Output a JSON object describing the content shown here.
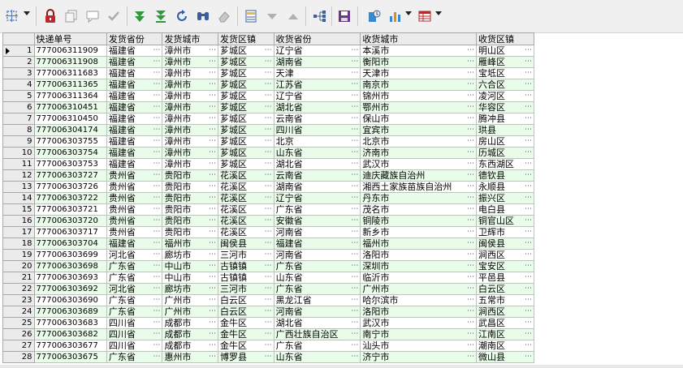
{
  "toolbar": {
    "buttons": [
      {
        "name": "column-config-icon",
        "dropdown": true
      },
      {
        "name": "lock-icon"
      },
      {
        "name": "copy-icon"
      },
      {
        "name": "chat-icon"
      },
      {
        "name": "check-icon"
      },
      {
        "name": "expand-down-icon"
      },
      {
        "name": "expand-all-icon"
      },
      {
        "name": "refresh-icon"
      },
      {
        "name": "find-icon"
      },
      {
        "name": "eraser-icon"
      },
      {
        "name": "group-panel-icon"
      },
      {
        "name": "sort-down-icon"
      },
      {
        "name": "sort-up-icon"
      },
      {
        "name": "tree-icon"
      },
      {
        "name": "save-icon"
      },
      {
        "name": "export-icon"
      },
      {
        "name": "chart-icon",
        "dropdown": true
      },
      {
        "name": "grid-layout-icon",
        "dropdown": true
      }
    ]
  },
  "grid": {
    "columns": [
      "快递单号",
      "发货省份",
      "发货城市",
      "发货区镇",
      "收货省份",
      "收货城市",
      "收货区镇"
    ],
    "rows": [
      [
        "1",
        "777006311909",
        "福建省",
        "漳州市",
        "芗城区",
        "辽宁省",
        "本溪市",
        "明山区"
      ],
      [
        "2",
        "777006311908",
        "福建省",
        "漳州市",
        "芗城区",
        "湖南省",
        "衡阳市",
        "雁峰区"
      ],
      [
        "3",
        "777006311683",
        "福建省",
        "漳州市",
        "芗城区",
        "天津",
        "天津市",
        "宝坻区"
      ],
      [
        "4",
        "777006311365",
        "福建省",
        "漳州市",
        "芗城区",
        "江苏省",
        "南京市",
        "六合区"
      ],
      [
        "5",
        "777006311364",
        "福建省",
        "漳州市",
        "芗城区",
        "辽宁省",
        "锦州市",
        "凌河区"
      ],
      [
        "6",
        "777006310451",
        "福建省",
        "漳州市",
        "芗城区",
        "湖北省",
        "鄂州市",
        "华容区"
      ],
      [
        "7",
        "777006310450",
        "福建省",
        "漳州市",
        "芗城区",
        "云南省",
        "保山市",
        "腾冲县"
      ],
      [
        "8",
        "777006304174",
        "福建省",
        "漳州市",
        "芗城区",
        "四川省",
        "宜宾市",
        "珙县"
      ],
      [
        "9",
        "777006303755",
        "福建省",
        "漳州市",
        "芗城区",
        "北京",
        "北京市",
        "房山区"
      ],
      [
        "10",
        "777006303754",
        "福建省",
        "漳州市",
        "芗城区",
        "山东省",
        "济南市",
        "历城区"
      ],
      [
        "11",
        "777006303753",
        "福建省",
        "漳州市",
        "芗城区",
        "湖北省",
        "武汉市",
        "东西湖区"
      ],
      [
        "12",
        "777006303727",
        "贵州省",
        "贵阳市",
        "花溪区",
        "云南省",
        "迪庆藏族自治州",
        "德钦县"
      ],
      [
        "13",
        "777006303726",
        "贵州省",
        "贵阳市",
        "花溪区",
        "湖南省",
        "湘西土家族苗族自治州",
        "永顺县"
      ],
      [
        "14",
        "777006303722",
        "贵州省",
        "贵阳市",
        "花溪区",
        "辽宁省",
        "丹东市",
        "振兴区"
      ],
      [
        "15",
        "777006303721",
        "贵州省",
        "贵阳市",
        "花溪区",
        "广东省",
        "茂名市",
        "电白县"
      ],
      [
        "16",
        "777006303720",
        "贵州省",
        "贵阳市",
        "花溪区",
        "安徽省",
        "铜陵市",
        "铜官山区"
      ],
      [
        "17",
        "777006303717",
        "贵州省",
        "贵阳市",
        "花溪区",
        "河南省",
        "新乡市",
        "卫辉市"
      ],
      [
        "18",
        "777006303704",
        "福建省",
        "福州市",
        "闽侯县",
        "福建省",
        "福州市",
        "闽侯县"
      ],
      [
        "19",
        "777006303699",
        "河北省",
        "廊坊市",
        "三河市",
        "河南省",
        "洛阳市",
        "涧西区"
      ],
      [
        "20",
        "777006303698",
        "广东省",
        "中山市",
        "古镇镇",
        "广东省",
        "深圳市",
        "宝安区"
      ],
      [
        "21",
        "777006303693",
        "广东省",
        "中山市",
        "古镇镇",
        "山东省",
        "临沂市",
        "平邑县"
      ],
      [
        "22",
        "777006303692",
        "河北省",
        "廊坊市",
        "三河市",
        "广东省",
        "广州市",
        "白云区"
      ],
      [
        "23",
        "777006303690",
        "广东省",
        "广州市",
        "白云区",
        "黑龙江省",
        "哈尔滨市",
        "五常市"
      ],
      [
        "24",
        "777006303689",
        "广东省",
        "广州市",
        "白云区",
        "河南省",
        "洛阳市",
        "涧西区"
      ],
      [
        "25",
        "777006303683",
        "四川省",
        "成都市",
        "金牛区",
        "湖北省",
        "武汉市",
        "武昌区"
      ],
      [
        "26",
        "777006303682",
        "四川省",
        "成都市",
        "金牛区",
        "广西壮族自治区",
        "南宁市",
        "江南区"
      ],
      [
        "27",
        "777006303677",
        "四川省",
        "成都市",
        "金牛区",
        "广东省",
        "汕头市",
        "潮南区"
      ],
      [
        "28",
        "777006303675",
        "广东省",
        "惠州市",
        "博罗县",
        "山东省",
        "济宁市",
        "微山县"
      ]
    ]
  }
}
